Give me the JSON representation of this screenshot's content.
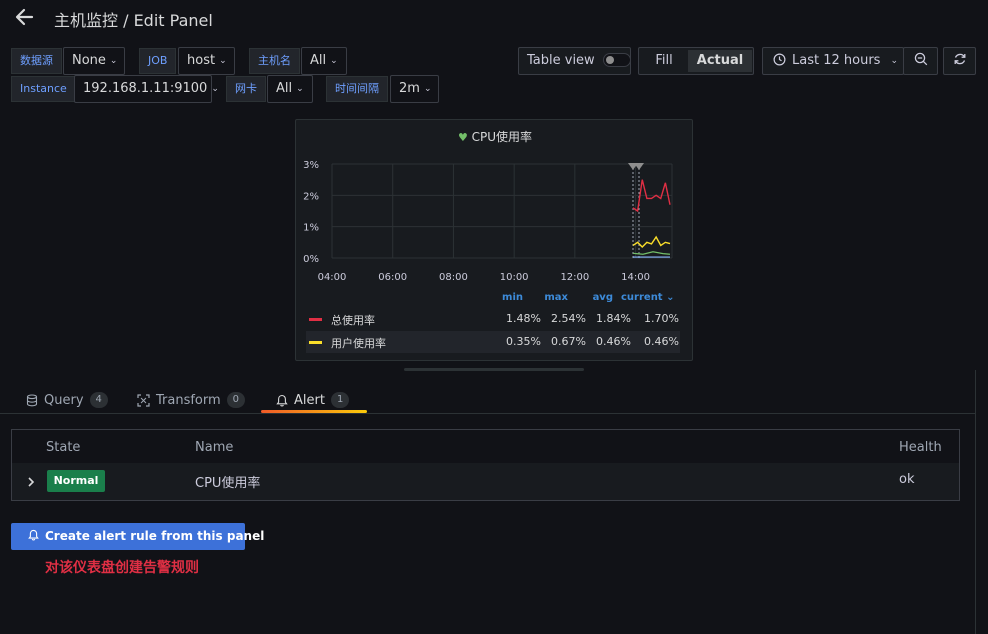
{
  "header": {
    "title": "主机监控 / Edit Panel"
  },
  "variables": {
    "datasource": {
      "label": "数据源",
      "value": "None"
    },
    "job": {
      "label": "JOB",
      "value": "host"
    },
    "hostname": {
      "label": "主机名",
      "value": "All"
    },
    "instance": {
      "label": "Instance",
      "value": "192.168.1.11:9100"
    },
    "nic": {
      "label": "网卡",
      "value": "All"
    },
    "interval": {
      "label": "时间间隔",
      "value": "2m"
    }
  },
  "toolbar": {
    "table_view": "Table view",
    "table_view_on": false,
    "fill": "Fill",
    "actual": "Actual",
    "active_mode": "Actual",
    "time_range": "Last 12 hours"
  },
  "panel": {
    "title": "CPU使用率",
    "legend_headers": [
      "min",
      "max",
      "avg",
      "current"
    ]
  },
  "chart_data": {
    "type": "line",
    "title": "CPU使用率",
    "x_ticks": [
      "04:00",
      "06:00",
      "08:00",
      "10:00",
      "12:00",
      "14:00"
    ],
    "y_ticks": [
      "0%",
      "1%",
      "2%",
      "3%"
    ],
    "ylim": [
      0,
      3
    ],
    "grid": true,
    "legend_placement": "bottom",
    "series": [
      {
        "name": "总使用率",
        "color": "#e02f44",
        "stats": {
          "min": "1.48%",
          "max": "2.54%",
          "avg": "1.84%",
          "current": "1.70%"
        },
        "values": [
          1.6,
          1.5,
          2.5,
          1.9,
          1.9,
          2.0,
          1.9,
          2.4,
          1.7
        ]
      },
      {
        "name": "用户使用率",
        "color": "#fade2a",
        "stats": {
          "min": "0.35%",
          "max": "0.67%",
          "avg": "0.46%",
          "current": "0.46%"
        },
        "values": [
          0.4,
          0.5,
          0.35,
          0.5,
          0.45,
          0.67,
          0.4,
          0.5,
          0.46
        ]
      }
    ],
    "extra_series_colors": [
      "#73bf69",
      "#8ab8ff"
    ]
  },
  "tabs": [
    {
      "label": "Query",
      "count": "4",
      "icon": "database-icon"
    },
    {
      "label": "Transform",
      "count": "0",
      "icon": "transform-icon"
    },
    {
      "label": "Alert",
      "count": "1",
      "icon": "bell-icon",
      "active": true
    }
  ],
  "alert_table": {
    "headers": {
      "state": "State",
      "name": "Name",
      "health": "Health"
    },
    "rows": [
      {
        "state": "Normal",
        "name": "CPU使用率",
        "health": "ok"
      }
    ]
  },
  "create_button": "Create alert rule from this panel",
  "annotation": "对该仪表盘创建告警规则",
  "colors": {
    "accent": "#3d71d9",
    "normal": "#1a7f4b",
    "annotation": "#e02f44"
  }
}
